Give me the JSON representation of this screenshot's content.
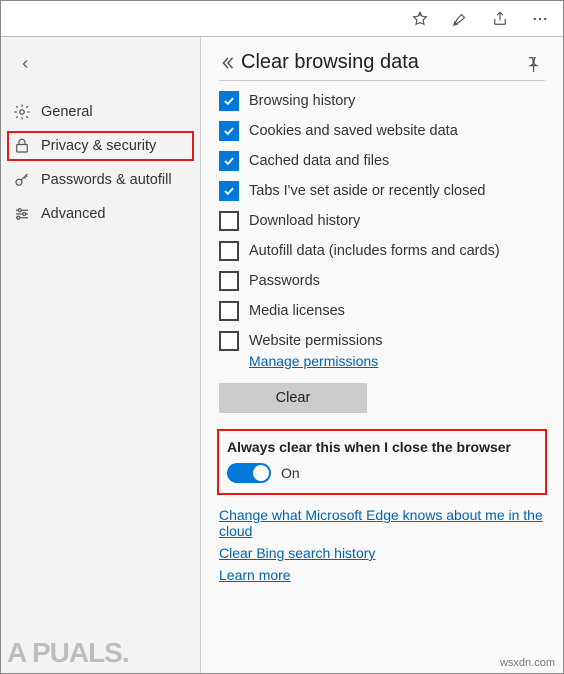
{
  "toolbar": {
    "favorites_aria": "Favorites",
    "ink_aria": "Add notes",
    "share_aria": "Share",
    "more_aria": "Settings and more"
  },
  "sidebar": {
    "collapse_aria": "Collapse menu",
    "items": [
      {
        "icon": "gear-icon",
        "label": "General"
      },
      {
        "icon": "lock-icon",
        "label": "Privacy & security"
      },
      {
        "icon": "key-icon",
        "label": "Passwords & autofill"
      },
      {
        "icon": "sliders-icon",
        "label": "Advanced"
      }
    ]
  },
  "panel": {
    "back_aria": "Back",
    "title": "Clear browsing data",
    "pin_aria": "Pin this pane",
    "options": [
      {
        "label": "Browsing history",
        "checked": true
      },
      {
        "label": "Cookies and saved website data",
        "checked": true
      },
      {
        "label": "Cached data and files",
        "checked": true
      },
      {
        "label": "Tabs I've set aside or recently closed",
        "checked": true
      },
      {
        "label": "Download history",
        "checked": false
      },
      {
        "label": "Autofill data (includes forms and cards)",
        "checked": false
      },
      {
        "label": "Passwords",
        "checked": false
      },
      {
        "label": "Media licenses",
        "checked": false
      },
      {
        "label": "Website permissions",
        "checked": false
      }
    ],
    "manage_permissions": "Manage permissions",
    "clear_button": "Clear",
    "always": {
      "title": "Always clear this when I close the browser",
      "state_label": "On",
      "enabled": true
    },
    "links": {
      "change_cloud": "Change what Microsoft Edge knows about me in the cloud",
      "bing_history": "Clear Bing search history",
      "learn_more": "Learn more"
    }
  },
  "watermark": "A  PUALS.",
  "credit": "wsxdn.com"
}
